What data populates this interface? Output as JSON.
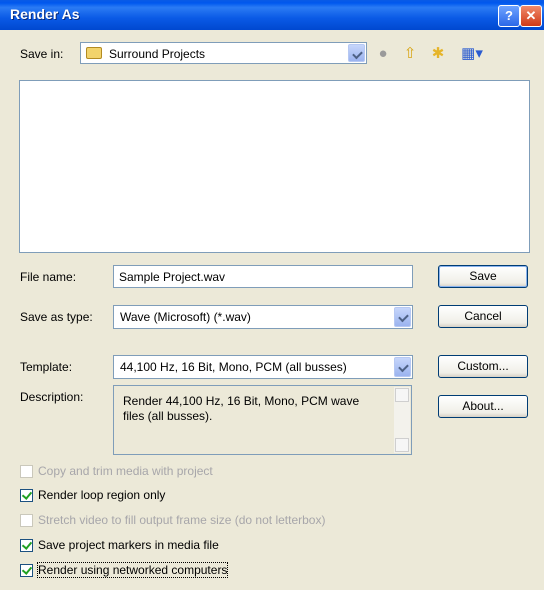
{
  "window": {
    "title": "Render As"
  },
  "toolbar": {
    "save_in_label": "Save in:",
    "save_in_value": "Surround Projects",
    "icons": [
      "back-icon",
      "up-folder-icon",
      "new-folder-icon",
      "view-menu-icon"
    ]
  },
  "file_name": {
    "label": "File name:",
    "value": "Sample Project.wav"
  },
  "save_as_type": {
    "label": "Save as type:",
    "value": "Wave (Microsoft) (*.wav)"
  },
  "template": {
    "label": "Template:",
    "value": "44,100 Hz, 16 Bit, Mono, PCM (all busses)"
  },
  "description": {
    "label": "Description:",
    "text": "Render 44,100 Hz, 16 Bit, Mono, PCM wave files (all busses)."
  },
  "buttons": {
    "save": "Save",
    "cancel": "Cancel",
    "custom": "Custom...",
    "about": "About..."
  },
  "options": [
    {
      "label": "Copy and trim media with project",
      "checked": false,
      "enabled": false
    },
    {
      "label": "Render loop region only",
      "checked": true,
      "enabled": true
    },
    {
      "label": "Stretch video to fill output frame size (do not letterbox)",
      "checked": false,
      "enabled": false
    },
    {
      "label": "Save project markers in media file",
      "checked": true,
      "enabled": true
    },
    {
      "label": "Render using networked computers",
      "checked": true,
      "enabled": true
    }
  ]
}
